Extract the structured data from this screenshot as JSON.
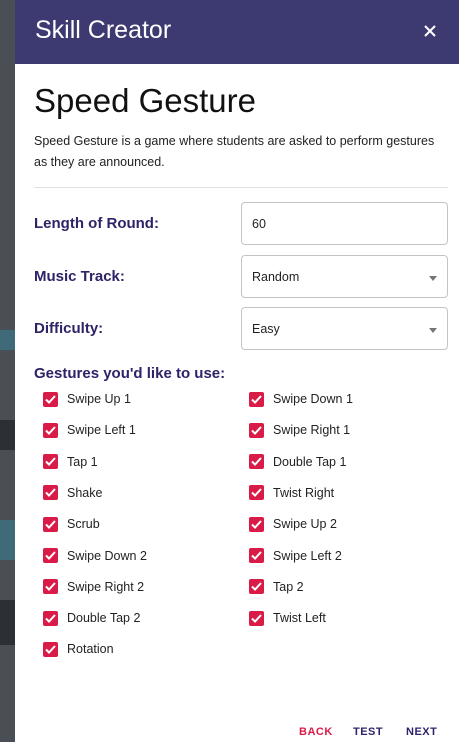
{
  "header": {
    "title": "Skill Creator",
    "close_icon": "close-icon"
  },
  "skill": {
    "name": "Speed Gesture",
    "description": "Speed Gesture is a game where students are asked to perform gestures as they are announced."
  },
  "settings": {
    "length_label": "Length of Round:",
    "length_value": "60",
    "music_label": "Music Track:",
    "music_value": "Random",
    "difficulty_label": "Difficulty:",
    "difficulty_value": "Easy"
  },
  "gestures": {
    "title": "Gestures you'd like to use:",
    "items": [
      {
        "label": "Swipe Up 1",
        "checked": true
      },
      {
        "label": "Swipe Down 1",
        "checked": true
      },
      {
        "label": "Swipe Left 1",
        "checked": true
      },
      {
        "label": "Swipe Right 1",
        "checked": true
      },
      {
        "label": "Tap 1",
        "checked": true
      },
      {
        "label": "Double Tap 1",
        "checked": true
      },
      {
        "label": "Shake",
        "checked": true
      },
      {
        "label": "Twist Right",
        "checked": true
      },
      {
        "label": "Scrub",
        "checked": true
      },
      {
        "label": "Swipe Up 2",
        "checked": true
      },
      {
        "label": "Swipe Down 2",
        "checked": true
      },
      {
        "label": "Swipe Left 2",
        "checked": true
      },
      {
        "label": "Swipe Right 2",
        "checked": true
      },
      {
        "label": "Tap 2",
        "checked": true
      },
      {
        "label": "Double Tap 2",
        "checked": true
      },
      {
        "label": "Twist Left",
        "checked": true
      },
      {
        "label": "Rotation",
        "checked": true
      }
    ]
  },
  "footer": {
    "back": "BACK",
    "test": "TEST",
    "next": "NEXT"
  },
  "colors": {
    "header": "#3d3a72",
    "accent": "#d81b47",
    "label": "#2d2468"
  }
}
